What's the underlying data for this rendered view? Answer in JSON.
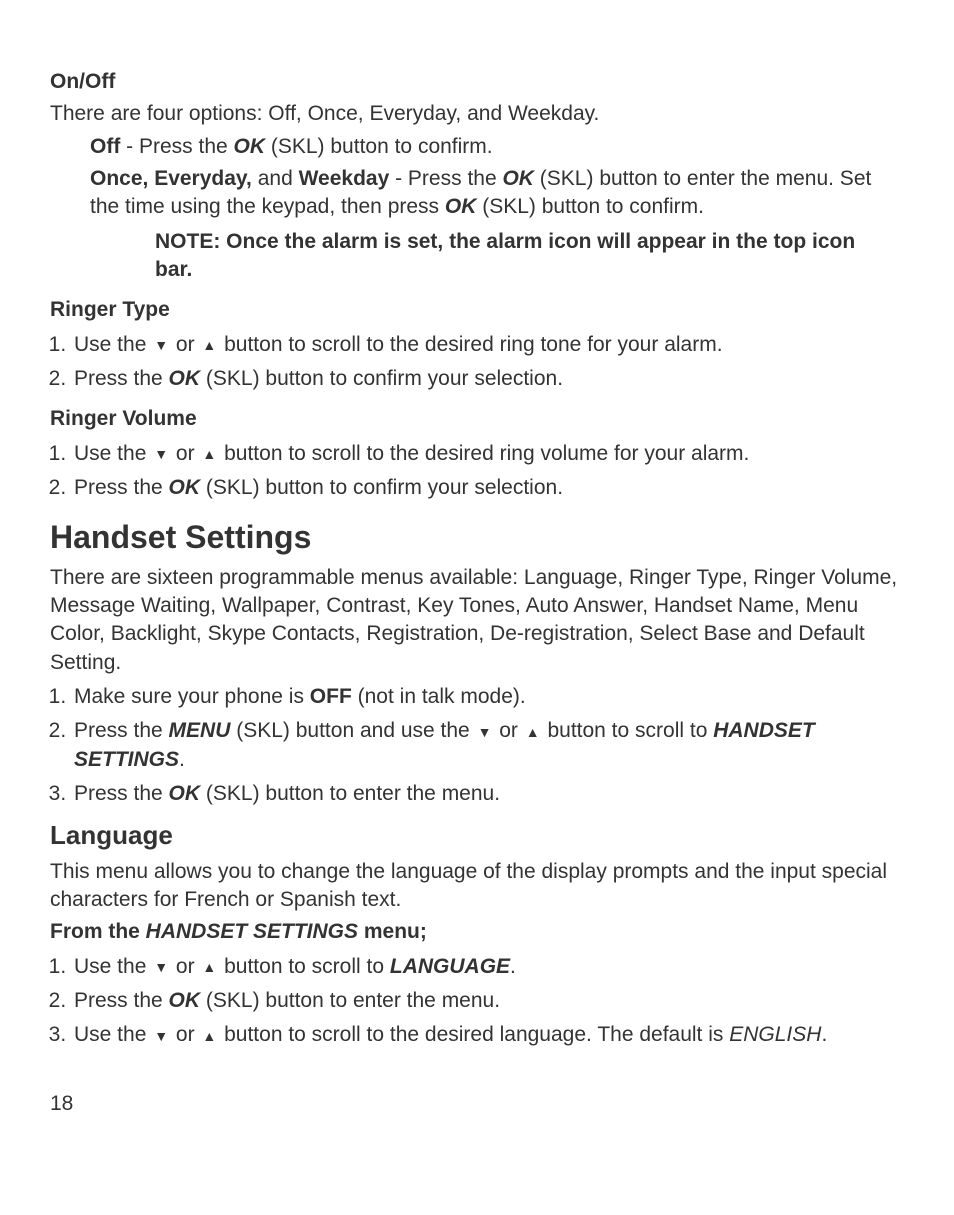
{
  "onoff": {
    "heading": "On/Off",
    "intro": "There are four options: Off, Once, Everyday, and Weekday.",
    "off_label": "Off",
    "off_rest": " - Press the ",
    "ok": "OK",
    "off_tail": " (SKL) button to confirm.",
    "once_label": "Once, Everyday,",
    "once_mid": " and ",
    "weekday_label": "Weekday",
    "once_rest1": " -  Press the ",
    "once_rest2": " (SKL) button to enter the menu. Set the time using the keypad, then press ",
    "once_rest3": " (SKL) button to confirm.",
    "note": "NOTE: Once the alarm is set, the alarm icon will appear in the top icon bar."
  },
  "ringer_type": {
    "heading": "Ringer Type",
    "step1a": "Use the ",
    "step1b": " or ",
    "step1c": "  button to scroll to the desired ring tone for your alarm.",
    "step2a": "Press the ",
    "step2b": " (SKL) button to confirm your selection."
  },
  "ringer_volume": {
    "heading": "Ringer Volume",
    "step1a": "Use the ",
    "step1b": " or ",
    "step1c": "  button to scroll to the desired ring volume for your alarm.",
    "step2a": "Press the ",
    "step2b": " (SKL) button to confirm your selection."
  },
  "handset": {
    "heading": "Handset Settings",
    "intro": "There are sixteen programmable menus available: Language, Ringer Type, Ringer Volume, Message Waiting, Wallpaper, Contrast, Key Tones, Auto Answer, Handset Name, Menu Color, Backlight, Skype Contacts, Registration, De-registration, Select Base and Default Setting.",
    "step1a": "Make sure your phone is ",
    "step1_off": "OFF",
    "step1b": " (not in talk mode).",
    "step2a": "Press the ",
    "menu": "MENU",
    "step2b": " (SKL) button and use the ",
    "step2c": " or ",
    "step2d": " button to scroll to ",
    "handset_settings": "HANDSET SETTINGS",
    "period": ".",
    "step3a": "Press the ",
    "step3b": " (SKL) button to enter the menu."
  },
  "language": {
    "heading": "Language",
    "intro": "This menu allows you to change the language of the display prompts and the input special characters for French or Spanish text.",
    "from_label_a": "From the ",
    "from_label_b": "HANDSET SETTINGS",
    "from_label_c": " menu;",
    "step1a": "Use the ",
    "step1b": " or ",
    "step1c": "  button to scroll to ",
    "language_word": "LANGUAGE",
    "step2a": "Press the ",
    "step2b": " (SKL) button to enter the menu.",
    "step3a": "Use the ",
    "step3b": " or ",
    "step3c": "  button to scroll to the desired language. The default is ",
    "english": "ENGLISH"
  },
  "icons": {
    "down": "▼",
    "up": "▲"
  },
  "ok": "OK",
  "page": "18"
}
